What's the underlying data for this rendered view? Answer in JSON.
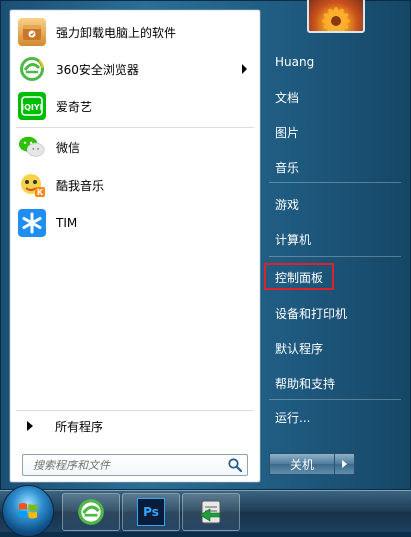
{
  "left_panel": {
    "programs": [
      {
        "label": "强力卸载电脑上的软件",
        "icon": "uninstall-box-icon",
        "has_submenu": false
      },
      {
        "label": "360安全浏览器",
        "icon": "360-browser-icon",
        "has_submenu": true
      },
      {
        "label": "爱奇艺",
        "icon": "iqiyi-icon",
        "has_submenu": false
      },
      {
        "label": "微信",
        "icon": "wechat-icon",
        "has_submenu": false
      },
      {
        "label": "酷我音乐",
        "icon": "kuwo-music-icon",
        "has_submenu": false
      },
      {
        "label": "TIM",
        "icon": "tim-icon",
        "has_submenu": false
      }
    ],
    "all_programs": "所有程序",
    "search_placeholder": "搜索程序和文件"
  },
  "right_panel": {
    "user": "Huang",
    "items": [
      "文档",
      "图片",
      "音乐",
      "游戏",
      "计算机",
      "控制面板",
      "设备和打印机",
      "默认程序",
      "帮助和支持",
      "运行..."
    ],
    "highlighted_item": "控制面板",
    "shutdown_label": "关机"
  },
  "taskbar": {
    "apps": [
      "360-browser-icon",
      "photoshop-icon",
      "ftp-icon"
    ],
    "photoshop_text": "Ps"
  },
  "colors": {
    "highlight_border": "#e0202a",
    "menu_glass": "#2a6f96"
  }
}
